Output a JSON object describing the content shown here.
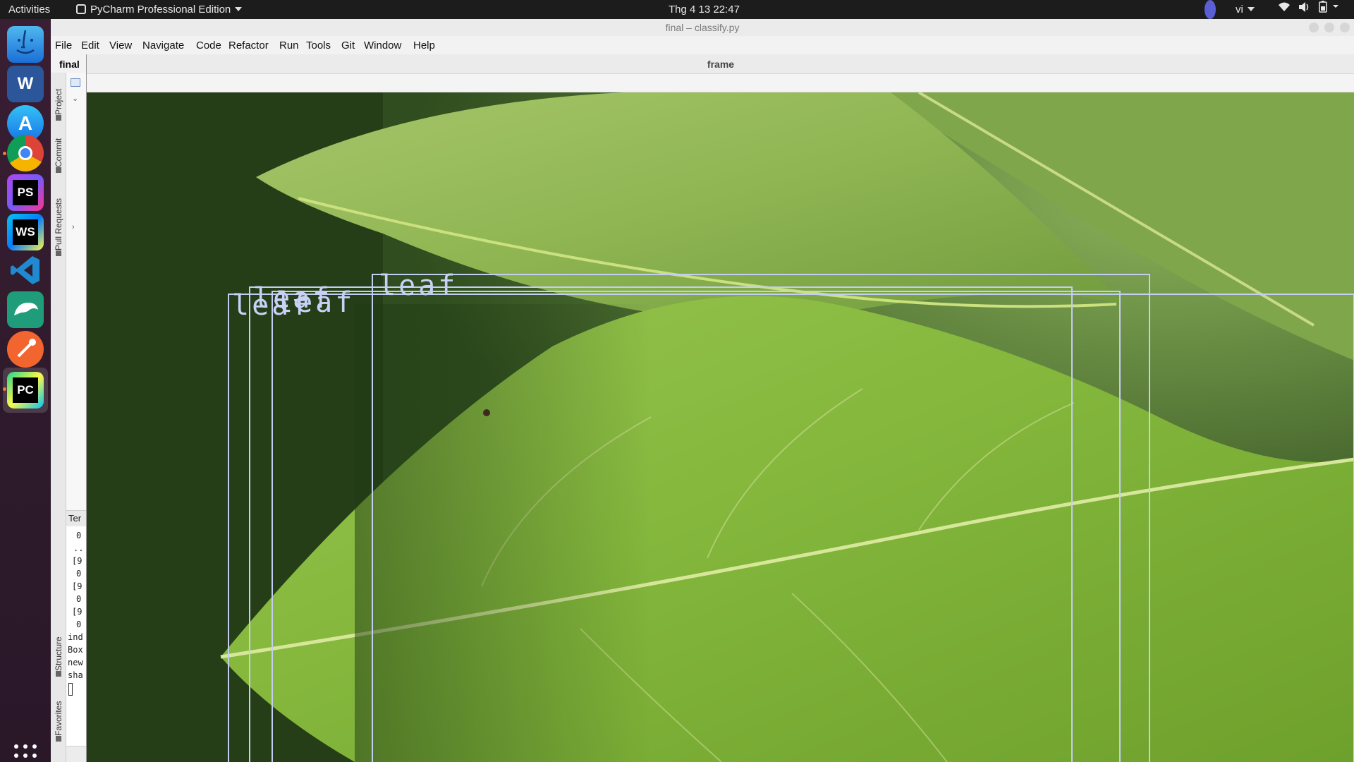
{
  "topbar": {
    "activities": "Activities",
    "app_menu": "PyCharm Professional Edition",
    "clock": "Thg 4 13  22:47",
    "lang": "vi"
  },
  "dock": {
    "apps": [
      "finder-icon",
      "word-icon",
      "app-store-icon",
      "chrome-icon",
      "phpstorm-icon",
      "webstorm-icon",
      "vscode-icon",
      "mysql-workbench-icon",
      "postman-icon",
      "pycharm-icon"
    ],
    "phpstorm_label": "PS",
    "webstorm_label": "WS",
    "pycharm_label": "PC"
  },
  "window": {
    "title": "final – classify.py",
    "project_name": "final"
  },
  "menubar": {
    "items": [
      "File",
      "Edit",
      "View",
      "Navigate",
      "Code",
      "Refactor",
      "Run",
      "Tools",
      "Git",
      "Window",
      "Help"
    ]
  },
  "tool_tabs": {
    "project": "Project",
    "commit": "Commit",
    "pull_requests": "Pull Requests",
    "structure": "Structure",
    "favorites": "Favorites"
  },
  "terminal": {
    "tab_label": "Ter",
    "lines": [
      "0",
      "..",
      "[9",
      "0",
      "[9",
      "0",
      "[9",
      "0",
      "ind",
      "Box",
      "new",
      "sha"
    ]
  },
  "frame_window": {
    "title": "frame",
    "detections": [
      {
        "label": "leaf"
      },
      {
        "label": "leaf"
      },
      {
        "label": "leaf"
      },
      {
        "label": "leaf"
      }
    ],
    "box_color": "#c4cdf2"
  }
}
